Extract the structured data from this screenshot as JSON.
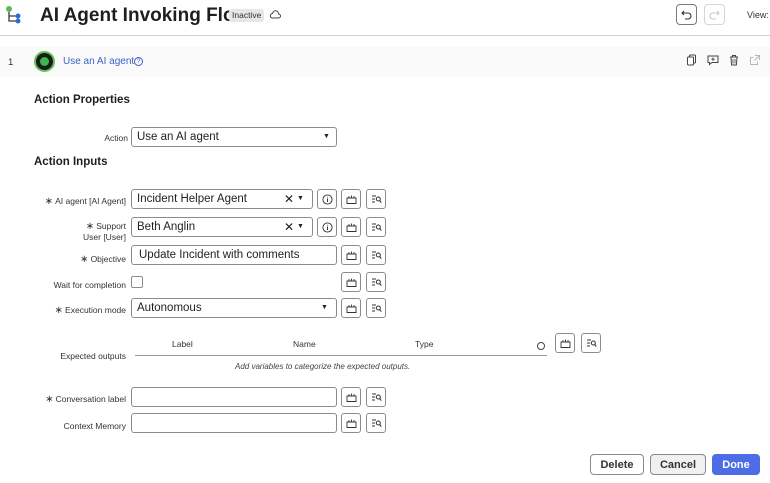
{
  "header": {
    "title": "AI Agent Invoking Flow",
    "status_badge": "Inactive",
    "view_label": "View:"
  },
  "step": {
    "number": "1",
    "action_link": "Use an AI agent"
  },
  "action_properties": {
    "section_title": "Action Properties",
    "action_label": "Action",
    "action_value": "Use an AI agent"
  },
  "action_inputs": {
    "section_title": "Action Inputs",
    "ai_agent": {
      "label": "AI agent [AI Agent]",
      "value": "Incident Helper Agent"
    },
    "support_user": {
      "label_line1": "Support",
      "label_line2": "User [User]",
      "value": "Beth Anglin"
    },
    "objective": {
      "label": "Objective",
      "value": "Update Incident with comments"
    },
    "wait_for_completion": {
      "label": "Wait for completion",
      "checked": false
    },
    "execution_mode": {
      "label": "Execution mode",
      "value": "Autonomous"
    },
    "expected_outputs": {
      "label": "Expected outputs",
      "columns": [
        "Label",
        "Name",
        "Type"
      ],
      "empty_message": "Add variables to categorize the expected outputs."
    },
    "conversation_label": {
      "label": "Conversation label",
      "value": ""
    },
    "context_memory": {
      "label": "Context Memory",
      "value": ""
    }
  },
  "footer": {
    "delete_label": "Delete",
    "cancel_label": "Cancel",
    "done_label": "Done"
  },
  "colors": {
    "accent": "#4e6ce6",
    "link": "#3a5fc8",
    "step_icon": "#3fb34f"
  }
}
